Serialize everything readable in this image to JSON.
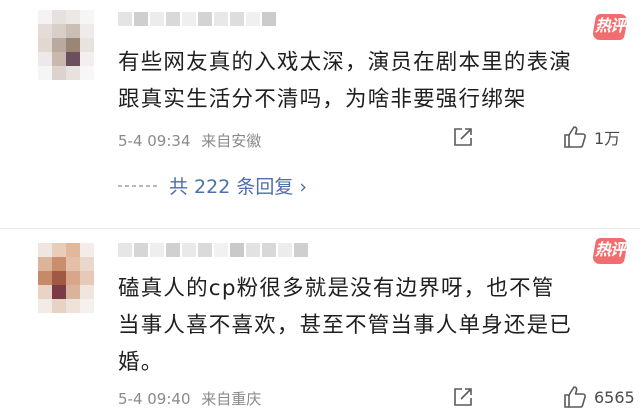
{
  "comments": [
    {
      "text_line1": "有些网友真的入戏太深，演员在剧本里的表演",
      "text_line2": "跟真实生活分不清吗，为啥非要强行绑架",
      "timestamp": "5-4 09:34",
      "location": "来自安徽",
      "likes": "1万",
      "badge": "热评",
      "replies": "共 222 条回复 ›"
    },
    {
      "text_line1": "磕真人的cp粉很多就是没有边界呀，也不管",
      "text_line2": "当事人喜不喜欢，甚至不管当事人单身还是已",
      "text_line3": "婚。",
      "timestamp": "5-4 09:40",
      "location": "来自重庆",
      "likes": "6565",
      "badge": "热评"
    }
  ],
  "colors": {
    "badge": "#f26e6e",
    "reply_link": "#4d6fa8",
    "meta": "#8a8a8a"
  },
  "icons": [
    "share-icon",
    "thumbs-up-icon"
  ]
}
